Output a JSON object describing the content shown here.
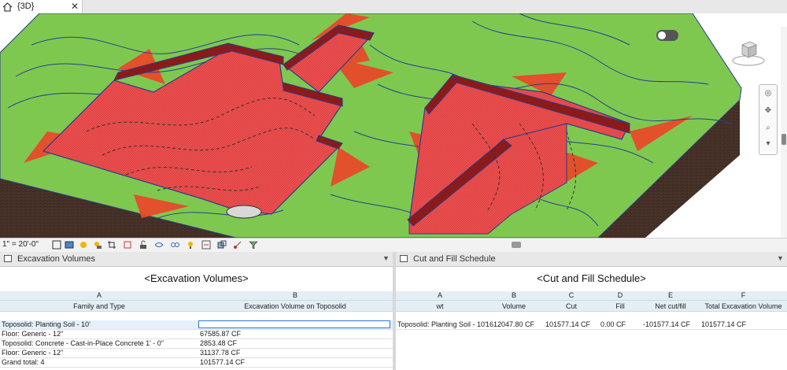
{
  "view_tab": {
    "title": "{3D}",
    "close": "✕"
  },
  "scale_label": "1\" = 20'-0\"",
  "colors": {
    "terrain": "#7ec850",
    "excavation": "#f25252",
    "cut_hatch": "#e84a2a",
    "contour": "#2a3d8f",
    "soil": "#4a342a"
  },
  "icons": [
    "home-icon",
    "close-icon",
    "toggle-icon",
    "viewcube-icon",
    "steering-wheel-icon",
    "zoom-icon",
    "pan-icon",
    "detail-level-icon",
    "visual-style-icon",
    "sun-path-icon",
    "shadows-icon",
    "crop-icon",
    "show-crop-icon",
    "unlock-icon",
    "temporary-hide-icon",
    "reveal-hidden-icon",
    "analytical-icon",
    "highlight-icon",
    "worksharing-icon",
    "constraints-icon",
    "view-filter-icon"
  ],
  "left_panel": {
    "title": "Excavation Volumes",
    "schedule_title": "<Excavation Volumes>",
    "columns": [
      {
        "letter": "A",
        "name": "Family and Type"
      },
      {
        "letter": "B",
        "name": "Excavation Volume on Toposolid"
      }
    ],
    "rows": [
      [
        "Toposolid: Planting Soil - 10'",
        ""
      ],
      [
        "Floor: Generic - 12\"",
        "67585.87 CF"
      ],
      [
        "Toposolid: Concrete - Cast-in-Place Concrete 1' - 0\"",
        "2853.48 CF"
      ],
      [
        "Floor: Generic - 12\"",
        "31137.78 CF"
      ],
      [
        "Grand total: 4",
        "101577.14 CF"
      ]
    ]
  },
  "right_panel": {
    "title": "Cut and Fill Schedule",
    "schedule_title": "<Cut and Fill Schedule>",
    "columns": [
      {
        "letter": "A",
        "name": "wt"
      },
      {
        "letter": "B",
        "name": "Volume"
      },
      {
        "letter": "C",
        "name": "Cut"
      },
      {
        "letter": "D",
        "name": "Fill"
      },
      {
        "letter": "E",
        "name": "Net cut/fill"
      },
      {
        "letter": "F",
        "name": "Total Excavation Volume"
      }
    ],
    "rows": [
      [
        "Toposolid: Planting Soil - 10'",
        "1612047.80 CF",
        "101577.14 CF",
        "0.00 CF",
        "-101577.14 CF",
        "101577.14 CF"
      ]
    ]
  }
}
